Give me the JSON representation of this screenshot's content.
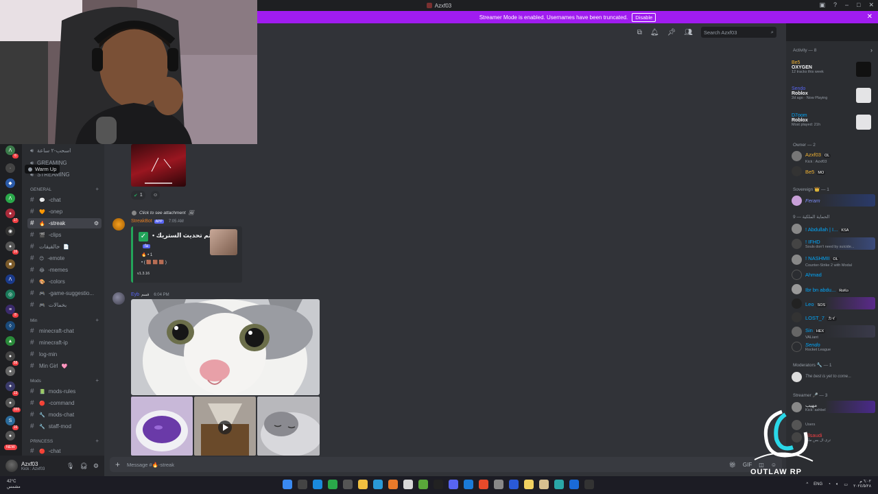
{
  "window": {
    "title": "Azxf03"
  },
  "banner": {
    "text": "Streamer Mode is enabled. Usernames have been truncated.",
    "disable": "Disable"
  },
  "search": {
    "placeholder": "Search Azxf03"
  },
  "tooltip": {
    "label": "Warm Up"
  },
  "channels": {
    "top": [
      {
        "label": "اسحب-٢ ساعة"
      },
      {
        "label": "GREAMING"
      },
      {
        "label": "STREAMING"
      }
    ],
    "general_label": "GENERAL",
    "general": [
      {
        "label": "-chat",
        "icon": "💬"
      },
      {
        "label": "-onep",
        "icon": "🧡"
      },
      {
        "label": "-streak",
        "icon": "🔥",
        "active": true
      },
      {
        "label": "-clips",
        "icon": "🎬"
      },
      {
        "label": "خالقيقات",
        "icon": "📄"
      },
      {
        "label": "-emote",
        "icon": "😊"
      },
      {
        "label": "-memes",
        "icon": "😂"
      },
      {
        "label": "-colors",
        "icon": "🎨"
      },
      {
        "label": "-game-suggestio...",
        "icon": "🎮"
      },
      {
        "label": "بخمالات",
        "icon": "🎮"
      }
    ],
    "min_label": "Min",
    "min": [
      {
        "label": "minecraft-chat"
      },
      {
        "label": "minecraft-ip"
      },
      {
        "label": "log-min"
      },
      {
        "label": "Min Girl",
        "icon": "🩷"
      }
    ],
    "mods_label": "Mods",
    "mods": [
      {
        "label": "mods-rules",
        "icon": "📗"
      },
      {
        "label": "-command",
        "icon": "🔴"
      },
      {
        "label": "mods-chat",
        "icon": "🔧"
      },
      {
        "label": "staff-mod",
        "icon": "🔧"
      }
    ],
    "princess_label": "PRINCESS",
    "princess": [
      {
        "label": "-chat",
        "icon": "🔴"
      }
    ]
  },
  "rail": {
    "new": "NEW",
    "badges": [
      "6",
      "17",
      "16",
      "8",
      "58",
      "13",
      "355",
      "16",
      "9"
    ]
  },
  "user": {
    "name": "Azxf03",
    "status": "Kick : Azxf03"
  },
  "messages": {
    "reaction_count": "1",
    "reply_text": "Click to see attachment",
    "bot_name": "StreakBot",
    "app_tag": "APP",
    "bot_time": "7:05 AM",
    "embed_title": "تم تحديث الستريك •",
    "embed_line1": "🔥 • 1",
    "embed_line2": "• ( 🟫 🟫 🟫 )",
    "embed_chip": "fa",
    "embed_version": "v1.3.16",
    "user2": "Eyb",
    "user2_tag": "قسم",
    "user2_time": "6:04 PM"
  },
  "composer": {
    "placeholder": "Message #🔥-streak"
  },
  "members": {
    "activity_label": "Activity — 8",
    "activity": [
      {
        "user": "Be5",
        "game": "OXYGEN",
        "sub": "12 tracks this week",
        "color": "#f0b232"
      },
      {
        "user": "Sendo",
        "game": "Roblox",
        "sub": "2d ago  · Now Playing",
        "color": "#5865f2"
      },
      {
        "user": "D7oom",
        "game": "Roblox",
        "sub": "Most played: 21h",
        "color": "#00a8fc"
      }
    ],
    "owner_label": "Owner — 2",
    "owner": [
      {
        "name": "Azxf03",
        "status": "Kick : Azxf03",
        "tag": "OL",
        "color": "#f0b232"
      },
      {
        "name": "Be5",
        "status": "",
        "tag": "MO",
        "color": "#f0b232"
      }
    ],
    "sovereign_label": "Sovereign 👑 — 1",
    "sovereign": [
      {
        "name": "Feram",
        "status": "",
        "tag": "",
        "color": "#5865f2"
      }
    ],
    "honor_label": "الحماية الملكية — 9",
    "honor": [
      {
        "name": "! Abdullah | I...",
        "status": "",
        "tag": "KSA",
        "color": "#00a8fc"
      },
      {
        "name": "! IFHD",
        "status": "Souls don't need by suicide...",
        "tag": "",
        "color": "#00a8fc"
      },
      {
        "name": "! NASHMII",
        "status": "Counter-Strike 2 with Modal",
        "tag": "OL",
        "color": "#00a8fc"
      },
      {
        "name": "Ahmad",
        "status": "",
        "tag": "",
        "color": "#00a8fc"
      },
      {
        "name": "Ibr bn abdu...",
        "status": "",
        "tag": "RoKo",
        "color": "#00a8fc"
      },
      {
        "name": "Leo",
        "status": "",
        "tag": "SOS",
        "color": "#00a8fc"
      },
      {
        "name": "LOST_7",
        "status": "",
        "tag": "カイ",
        "color": "#00a8fc"
      },
      {
        "name": "Sin",
        "status": "VALiant",
        "tag": "HEX",
        "color": "#00a8fc"
      },
      {
        "name": "Sendo",
        "status": "Rocket League",
        "tag": "",
        "color": "#00a8fc"
      }
    ],
    "moderators_label": "Moderators 🔧 — 1",
    "moderators": [
      {
        "name": "The best is yet to come...",
        "status": "",
        "tag": "",
        "color": "#949ba4"
      }
    ],
    "streamer_label": "Streamer 🎤 — 3",
    "streamer": [
      {
        "name": "مهيب",
        "status": "Kick: ashbel",
        "tag": "",
        "color": "#dbdee1"
      },
      {
        "name": "",
        "status": "Users",
        "tag": "",
        "color": "#dbdee1"
      },
      {
        "name": "Elsaudi",
        "status": "ترى ال بس ملكا",
        "tag": "",
        "color": "#f23f43"
      }
    ]
  },
  "taskbar": {
    "temp": "42°C",
    "weather": "مشمس",
    "lang": "ENG",
    "time": "٦:٠٢ م",
    "date": "٢٠٢٤/٥/٢٨"
  },
  "watermark": {
    "text": "OUTLAW RP"
  }
}
